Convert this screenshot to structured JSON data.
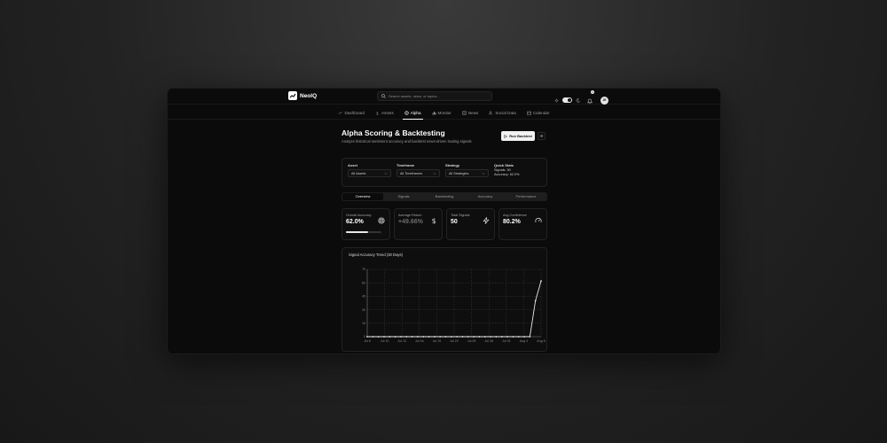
{
  "app": {
    "name": "NeoIQ",
    "avatar_initials": "JE",
    "notification_count": "1"
  },
  "search": {
    "placeholder": "Search assets, news, or topics..."
  },
  "nav": [
    {
      "label": "Dashboard",
      "icon": "trend-icon"
    },
    {
      "label": "Assets",
      "icon": "dollar-icon"
    },
    {
      "label": "Alpha",
      "icon": "target-icon",
      "active": true
    },
    {
      "label": "Monitor",
      "icon": "bar-chart-icon"
    },
    {
      "label": "News",
      "icon": "newspaper-icon"
    },
    {
      "label": "Social Data",
      "icon": "users-icon"
    },
    {
      "label": "Calendar",
      "icon": "calendar-icon"
    }
  ],
  "page": {
    "title": "Alpha Scoring & Backtesting",
    "subtitle": "Analyze historical sentiment accuracy and backtest news-driven trading signals",
    "run_button": "Run Backtest"
  },
  "filters": {
    "asset": {
      "label": "Asset",
      "value": "All Assets"
    },
    "timeframe": {
      "label": "Timeframe",
      "value": "All Timeframes"
    },
    "strategy": {
      "label": "Strategy",
      "value": "All Strategies"
    },
    "quick": {
      "label": "Quick Stats",
      "signals": "Signals: 50",
      "accuracy": "Accuracy: 62.0%"
    }
  },
  "tabs": [
    "Overview",
    "Signals",
    "Backtesting",
    "Accuracy",
    "Performance"
  ],
  "stats": {
    "accuracy": {
      "label": "Overall Accuracy",
      "value": "62.0%",
      "progress": 0.62
    },
    "return": {
      "label": "Average Return",
      "value": "+49.66%"
    },
    "signals": {
      "label": "Total Signals",
      "value": "50"
    },
    "confidence": {
      "label": "Avg Confidence",
      "value": "80.2%"
    }
  },
  "colors": {
    "accent": "#ffffff",
    "background": "#0b0b0b",
    "card": "#0e0e0e"
  },
  "chart_data": {
    "type": "line",
    "title": "Signal Accuracy Trend (30 Days)",
    "categories": [
      "Jul 6",
      "Jul 10",
      "Jul 13",
      "Jul 16",
      "Jul 19",
      "Jul 22",
      "Jul 25",
      "Jul 28",
      "Jul 31",
      "Aug 3",
      "Aug 6"
    ],
    "x": [
      "Jul 6",
      "Jul 7",
      "Jul 8",
      "Jul 9",
      "Jul 10",
      "Jul 11",
      "Jul 12",
      "Jul 13",
      "Jul 14",
      "Jul 15",
      "Jul 16",
      "Jul 17",
      "Jul 18",
      "Jul 19",
      "Jul 20",
      "Jul 21",
      "Jul 22",
      "Jul 23",
      "Jul 24",
      "Jul 25",
      "Jul 26",
      "Jul 27",
      "Jul 28",
      "Jul 29",
      "Jul 30",
      "Jul 31",
      "Aug 1",
      "Aug 2",
      "Aug 3",
      "Aug 4",
      "Aug 5",
      "Aug 6"
    ],
    "values": [
      0,
      0,
      0,
      0,
      0,
      0,
      0,
      0,
      0,
      0,
      0,
      0,
      0,
      0,
      0,
      0,
      0,
      0,
      0,
      0,
      0,
      0,
      0,
      0,
      0,
      0,
      0,
      0,
      0,
      0,
      40,
      62
    ],
    "yticks": [
      0,
      15,
      30,
      45,
      60,
      75
    ],
    "ylim": [
      0,
      75
    ],
    "grid": true
  }
}
